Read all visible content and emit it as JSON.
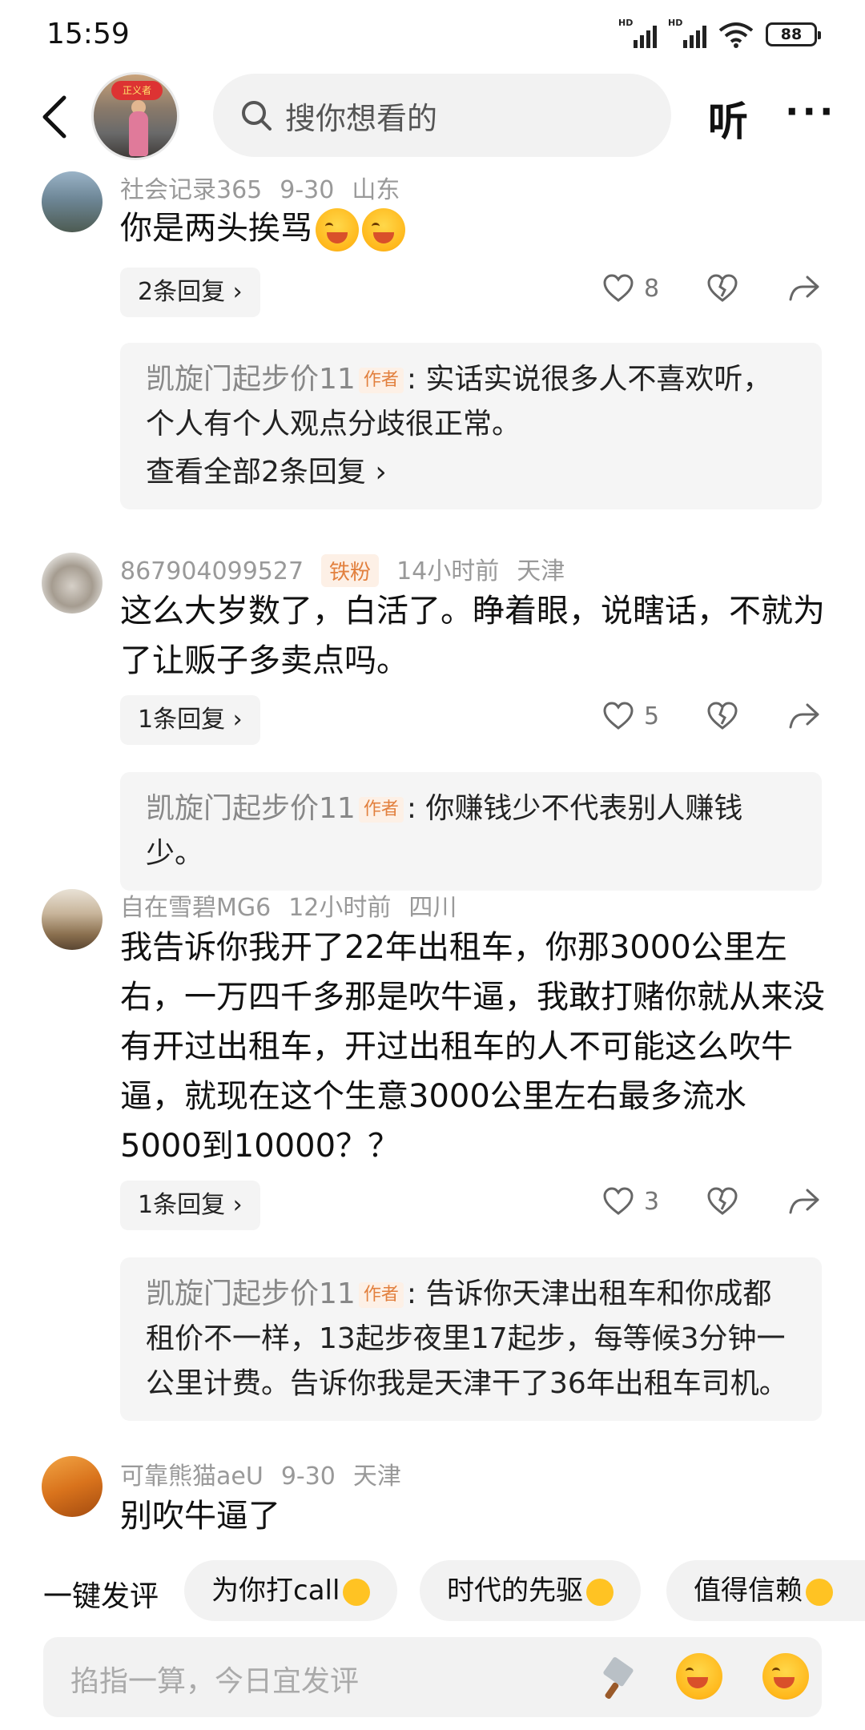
{
  "status_bar": {
    "time": "15:59",
    "hd1": "HD",
    "hd2": "HD",
    "battery": "88"
  },
  "nav": {
    "search_placeholder": "搜你想看的",
    "listen_label": "听",
    "more_label": "···",
    "avatar_badge": "正义者"
  },
  "comments": [
    {
      "user": "社会记录365",
      "date": "9-30",
      "location": "山东",
      "text": "你是两头挨骂",
      "emoji_count": 2,
      "replies_label": "2条回复 ›",
      "likes": "8",
      "reply": {
        "author": "凯旋门起步价11",
        "author_tag": "作者",
        "text": ": 实话实说很多人不喜欢听，个人有个人观点分歧很正常。",
        "view_all": "查看全部2条回复 ›"
      }
    },
    {
      "user": "867904099527",
      "badge": "铁粉",
      "date": "14小时前",
      "location": "天津",
      "text": "这么大岁数了，白活了。睁着眼，说瞎话，不就为了让贩子多卖点吗。",
      "replies_label": "1条回复 ›",
      "likes": "5",
      "reply": {
        "author": "凯旋门起步价11",
        "author_tag": "作者",
        "text": ": 你赚钱少不代表别人赚钱少。"
      }
    },
    {
      "user": "自在雪碧MG6",
      "date": "12小时前",
      "location": "四川",
      "text": "我告诉你我开了22年出租车，你那3000公里左右，一万四千多那是吹牛逼，我敢打赌你就从来没有开过出租车，开过出租车的人不可能这么吹牛逼，就现在这个生意3000公里左右最多流水5000到10000？？",
      "replies_label": "1条回复 ›",
      "likes": "3",
      "reply": {
        "author": "凯旋门起步价11",
        "author_tag": "作者",
        "text": ": 告诉你天津出租车和你成都租价不一样，13起步夜里17起步，每等候3分钟一公里计费。告诉你我是天津干了36年出租车司机。"
      }
    },
    {
      "user": "可靠熊猫aeU",
      "date": "9-30",
      "location": "天津",
      "text": "别吹牛逼了"
    }
  ],
  "quick_comment": {
    "label": "一键发评",
    "chips": [
      "为你打call",
      "时代的先驱",
      "值得信赖"
    ]
  },
  "composer": {
    "placeholder": "掐指一算，今日宜发评"
  },
  "colors": {
    "accent_tag": "#e2803e",
    "tag_bg": "#fdf0e6",
    "panel_bg": "#f5f5f5"
  }
}
